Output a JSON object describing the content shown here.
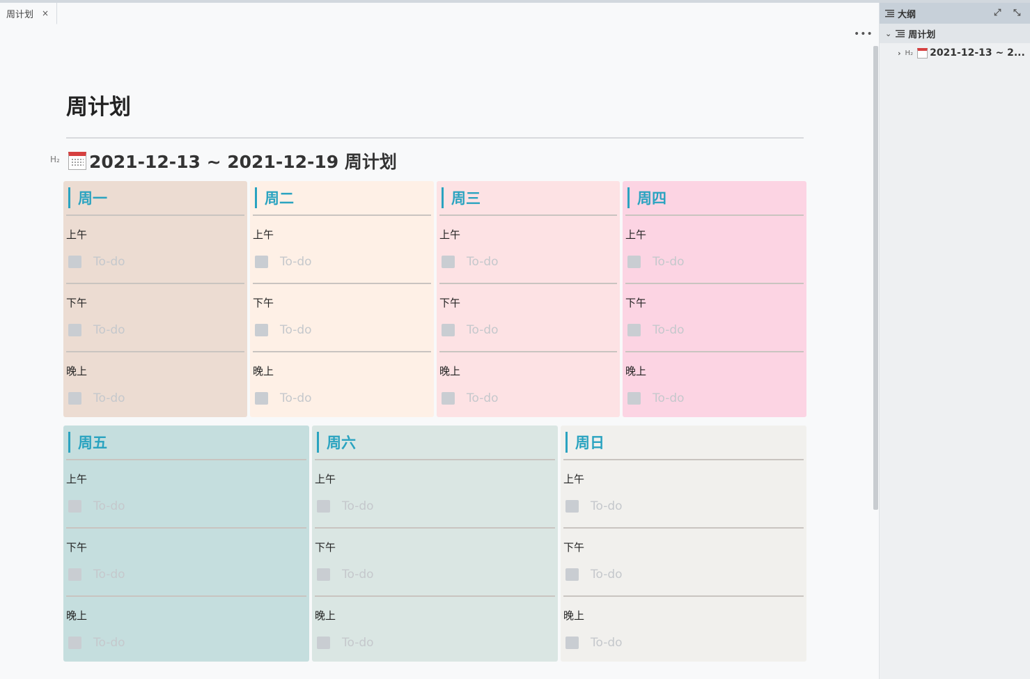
{
  "tab": {
    "title": "周计划",
    "close": "×"
  },
  "toolbar": {
    "more": "•••"
  },
  "document": {
    "title": "周计划",
    "h2_marker": "H₂",
    "week_heading": "2021-12-13 ~ 2021-12-19 周计划"
  },
  "slot_labels": [
    "上午",
    "下午",
    "晚上"
  ],
  "todo_placeholder": "To-do",
  "days": [
    {
      "name": "周一",
      "bg": "#ecdcd2"
    },
    {
      "name": "周二",
      "bg": "#fef0e6"
    },
    {
      "name": "周三",
      "bg": "#fde2e4"
    },
    {
      "name": "周四",
      "bg": "#fcd4e3"
    },
    {
      "name": "周五",
      "bg": "#c5dede"
    },
    {
      "name": "周六",
      "bg": "#dae6e3"
    },
    {
      "name": "周日",
      "bg": "#f1f0ed"
    }
  ],
  "outline": {
    "title": "大纲",
    "expand_icon": "⤢",
    "pin_icon": "⤡",
    "root": "周计划",
    "child_tag": "H₂",
    "child": "2021-12-13 ~ 2..."
  }
}
